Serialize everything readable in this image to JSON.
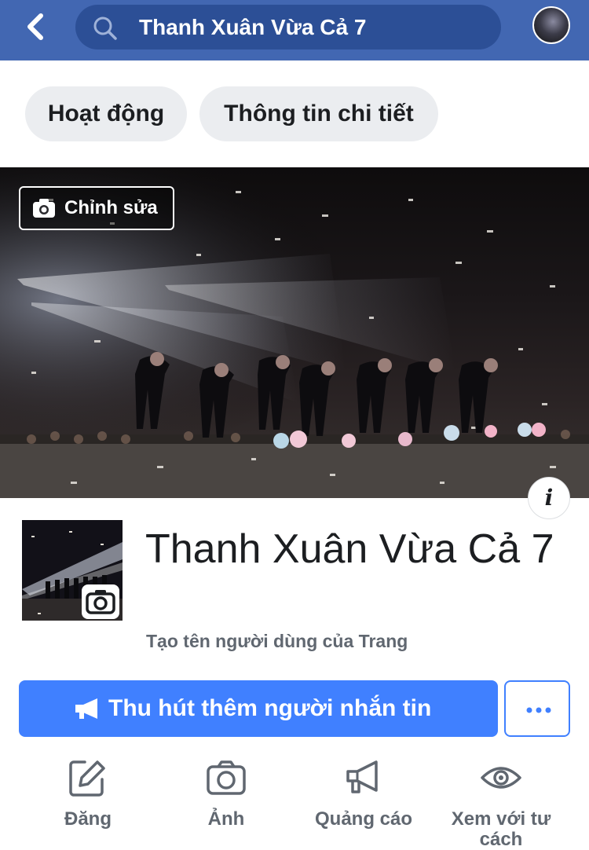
{
  "topbar": {
    "search_text": "Thanh Xuân Vừa Cả 7",
    "colors": {
      "bar": "#4267b2",
      "search_bg": "#2c4f96"
    }
  },
  "tabs": [
    {
      "label": "Hoạt động"
    },
    {
      "label": "Thông tin chi tiết"
    }
  ],
  "cover": {
    "edit_label": "Chỉnh sửa",
    "info_icon": "i"
  },
  "profile": {
    "name": "Thanh Xuân Vừa Cả 7",
    "username_prompt": "Tạo tên người dùng của Trang"
  },
  "actions": {
    "cta_label": "Thu hút thêm người nhắn tin",
    "more_icon": "more-dots-icon",
    "items": [
      {
        "label": "Đăng",
        "icon": "pencil-square-icon"
      },
      {
        "label": "Ảnh",
        "icon": "camera-icon"
      },
      {
        "label": "Quảng cáo",
        "icon": "megaphone-icon"
      },
      {
        "label": "Xem với tư cách",
        "icon": "eye-icon"
      }
    ],
    "colors": {
      "primary": "#4080ff",
      "muted": "#606770"
    }
  }
}
